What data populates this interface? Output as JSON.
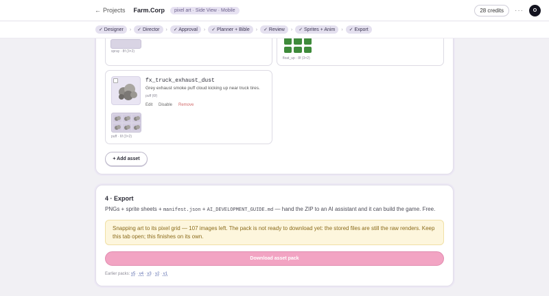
{
  "topbar": {
    "back_label": "Projects",
    "project_name": "Farm.Corp",
    "style_pill": "pixel art · Side View · Mobile",
    "credits": "28 credits",
    "avatar_initial": "O",
    "more": "···"
  },
  "steps": [
    "✓ Designer",
    "✓ Director",
    "✓ Approval",
    "✓ Planner + Bible",
    "✓ Review",
    "✓ Sprites + Anim",
    "✓ Export"
  ],
  "assets": {
    "top_left_caption": "spray · 8f (3×2)",
    "top_right_caption": "float_up · 8f (3×2)",
    "exhaust": {
      "name": "fx_truck_exhaust_dust",
      "description": "Grey exhaust smoke puff cloud kicking up near truck tires.",
      "anim": "puff (6f)",
      "edit": "Edit",
      "disable": "Disable",
      "remove": "Remove",
      "sheet_caption": "puff · 6f (3×2)"
    },
    "add_label": "+ Add asset"
  },
  "export": {
    "title": "4 · Export",
    "desc_prefix": "PNGs + sprite sheets + ",
    "manifest": "manifest.json",
    "plus": " + ",
    "guide": "AI_DEVELOPMENT_GUIDE.md",
    "desc_suffix": " — hand the ZIP to an AI assistant and it can build the game. Free.",
    "warning": "Snapping art to its pixel grid — 107 images left. The pack is not ready to download yet: the stored files are still the raw renders. Keep this tab open; this finishes on its own.",
    "download_label": "Download asset pack",
    "earlier_label": "Earlier packs:",
    "versions": [
      "v5",
      "v4",
      "v3",
      "v2",
      "v1"
    ]
  },
  "colors": {
    "accent": "#f2a4c3",
    "warning_bg": "#fdf6dd",
    "step_bg": "#e4e0ef"
  }
}
